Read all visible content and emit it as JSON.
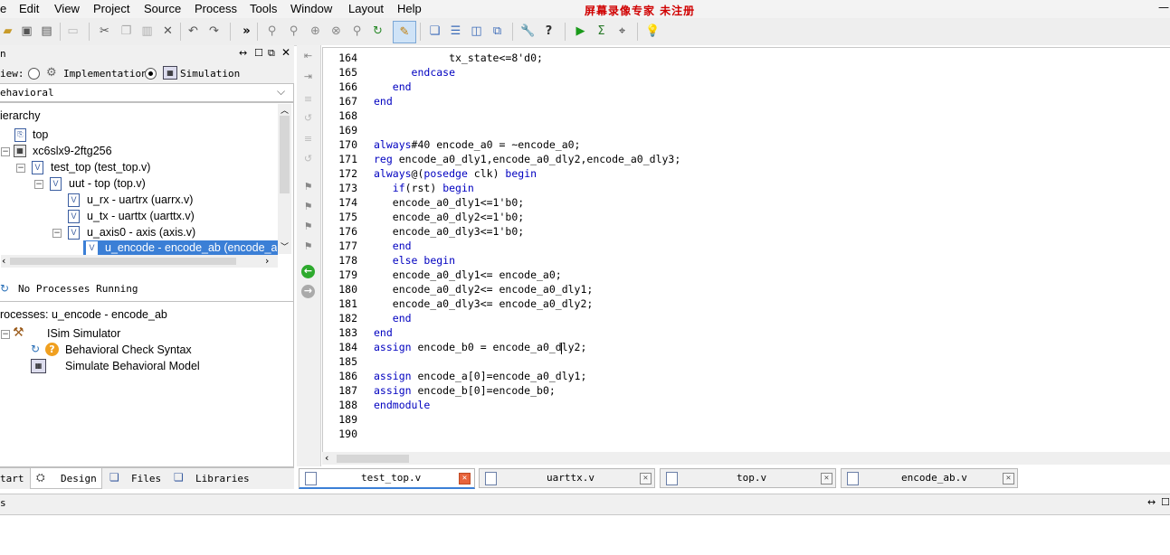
{
  "menubar": {
    "items": [
      "e",
      "Edit",
      "View",
      "Project",
      "Source",
      "Process",
      "Tools",
      "Window",
      "Layout",
      "Help"
    ],
    "watermark": "屏幕录像专家  未注册"
  },
  "design_panel": {
    "title": "n",
    "view_label": "iew:",
    "view_options": [
      "Implementation",
      "Simulation"
    ],
    "selected_view": "Simulation",
    "dropdown_value": "ehavioral",
    "hierarchy_title": "ierarchy",
    "tree": [
      {
        "label": "top"
      },
      {
        "label": "xc6slx9-2ftg256"
      },
      {
        "label": "test_top (test_top.v)"
      },
      {
        "label": "uut - top (top.v)"
      },
      {
        "label": "u_rx - uartrx (uarrx.v)"
      },
      {
        "label": "u_tx - uarttx (uarttx.v)"
      },
      {
        "label": "u_axis0 - axis (axis.v)"
      },
      {
        "label": "u_encode - encode_ab (encode_a"
      }
    ],
    "processes_status": "No Processes Running",
    "processes_title": "rocesses: u_encode - encode_ab",
    "processes": [
      {
        "label": "ISim Simulator"
      },
      {
        "label": "Behavioral Check Syntax"
      },
      {
        "label": "Simulate Behavioral Model"
      }
    ],
    "bottom_tabs": [
      "tart",
      "Design",
      "Files",
      "Libraries"
    ]
  },
  "editor": {
    "line_numbers": [
      "164",
      "165",
      "166",
      "167",
      "168",
      "169",
      "170",
      "171",
      "172",
      "173",
      "174",
      "175",
      "176",
      "177",
      "178",
      "179",
      "180",
      "181",
      "182",
      "183",
      "184",
      "185",
      "186",
      "187",
      "188",
      "189",
      "190"
    ],
    "lines": [
      [
        {
          "t": "            tx_state<=8'd0;"
        }
      ],
      [
        {
          "t": "      "
        },
        {
          "t": "endcase",
          "k": 1
        }
      ],
      [
        {
          "t": "   "
        },
        {
          "t": "end",
          "k": 1
        }
      ],
      [
        {
          "t": "end",
          "k": 1
        }
      ],
      [
        {
          "t": ""
        }
      ],
      [
        {
          "t": ""
        }
      ],
      [
        {
          "t": "always",
          "k": 1
        },
        {
          "t": "#40 encode_a0 = ~encode_a0;"
        }
      ],
      [
        {
          "t": "reg",
          "k": 1
        },
        {
          "t": " encode_a0_dly1,encode_a0_dly2,encode_a0_dly3;"
        }
      ],
      [
        {
          "t": "always",
          "k": 1
        },
        {
          "t": "@("
        },
        {
          "t": "posedge",
          "k": 1
        },
        {
          "t": " clk) "
        },
        {
          "t": "begin",
          "k": 1
        }
      ],
      [
        {
          "t": "   "
        },
        {
          "t": "if",
          "k": 1
        },
        {
          "t": "(rst) "
        },
        {
          "t": "begin",
          "k": 1
        }
      ],
      [
        {
          "t": "   encode_a0_dly1<=1'b0;"
        }
      ],
      [
        {
          "t": "   encode_a0_dly2<=1'b0;"
        }
      ],
      [
        {
          "t": "   encode_a0_dly3<=1'b0;"
        }
      ],
      [
        {
          "t": "   "
        },
        {
          "t": "end",
          "k": 1
        }
      ],
      [
        {
          "t": "   "
        },
        {
          "t": "else begin",
          "k": 1
        }
      ],
      [
        {
          "t": "   encode_a0_dly1<= encode_a0;"
        }
      ],
      [
        {
          "t": "   encode_a0_dly2<= encode_a0_dly1;"
        }
      ],
      [
        {
          "t": "   encode_a0_dly3<= encode_a0_dly2;"
        }
      ],
      [
        {
          "t": "   "
        },
        {
          "t": "end",
          "k": 1
        }
      ],
      [
        {
          "t": "end",
          "k": 1
        }
      ],
      [
        {
          "t": "assign",
          "k": 1
        },
        {
          "t": " encode_b0 = encode_a0_dly2;"
        }
      ],
      [
        {
          "t": ""
        }
      ],
      [
        {
          "t": "assign",
          "k": 1
        },
        {
          "t": " encode_a[0]=encode_a0_dly1;"
        }
      ],
      [
        {
          "t": "assign",
          "k": 1
        },
        {
          "t": " encode_b[0]=encode_b0;"
        }
      ],
      [
        {
          "t": "endmodule",
          "k": 1
        }
      ],
      [
        {
          "t": ""
        }
      ],
      [
        {
          "t": ""
        }
      ]
    ],
    "tabs": [
      {
        "label": "test_top.v"
      },
      {
        "label": "uarttx.v"
      },
      {
        "label": "top.v"
      },
      {
        "label": "encode_ab.v"
      }
    ]
  },
  "status": {
    "left": "s"
  }
}
